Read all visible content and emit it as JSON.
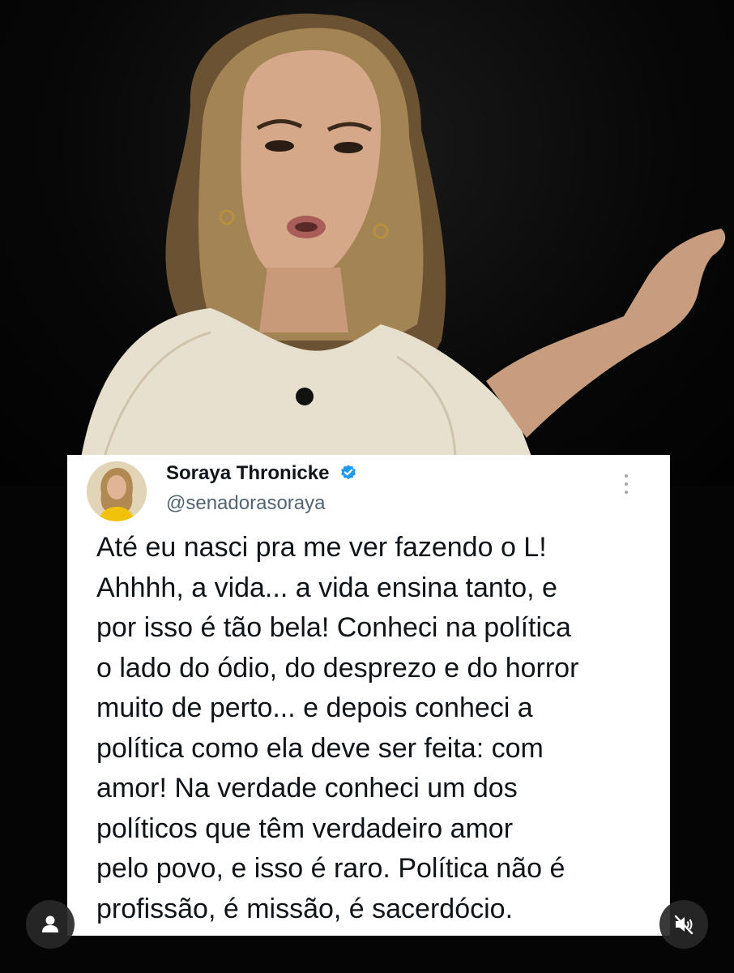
{
  "tweet": {
    "author_name": "Soraya Thronicke",
    "handle": "@senadorasoraya",
    "lines": [
      "Até eu nasci pra me ver fazendo o L!",
      "Ahhhh, a vida... a vida ensina tanto, e",
      "por isso é tão bela! Conheci na política",
      "o lado do ódio, do desprezo e do horror",
      "muito de perto... e depois conheci a",
      "política como ela deve ser feita: com",
      "amor! Na verdade conheci um dos",
      "políticos que têm verdadeiro amor",
      "pelo povo, e isso é raro. Política não é",
      "profissão, é missão, é sacerdócio."
    ],
    "verified_icon": "verified-badge-icon",
    "more_icon": "more-vertical-icon"
  },
  "overlay": {
    "profile_icon": "user-icon",
    "mute_icon": "muted-speaker-icon"
  },
  "colors": {
    "background": "#000000",
    "card": "#ffffff",
    "text": "#0f1419",
    "handle": "#536471",
    "verified": "#1d9bf0",
    "overlay_button": "#282828"
  }
}
